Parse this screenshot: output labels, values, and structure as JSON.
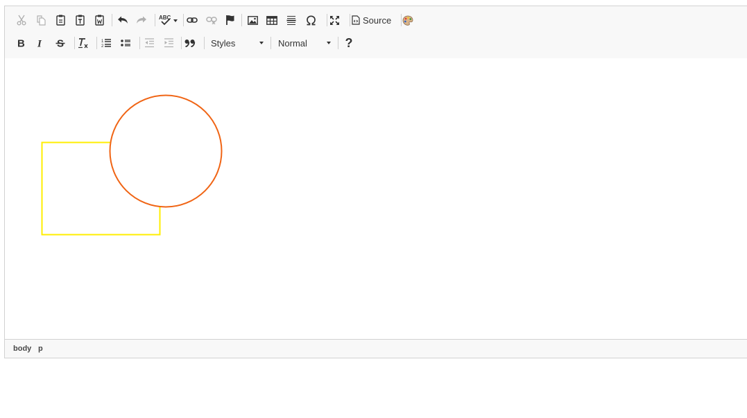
{
  "toolbar": {
    "source_label": "Source",
    "styles_label": "Styles",
    "format_label": "Normal",
    "help_label": "?",
    "icons": [
      "cut-icon",
      "copy-icon",
      "paste-icon",
      "paste-text-icon",
      "paste-word-icon",
      "undo-icon",
      "redo-icon",
      "spellcheck-icon",
      "link-icon",
      "unlink-icon",
      "anchor-icon",
      "image-icon",
      "table-icon",
      "horizontal-rule-icon",
      "special-char-omega-icon",
      "maximize-icon",
      "source-icon",
      "palette-icon",
      "bold-icon",
      "italic-icon",
      "strikethrough-icon",
      "remove-format-icon",
      "numbered-list-icon",
      "bulleted-list-icon",
      "outdent-icon",
      "indent-icon",
      "blockquote-icon",
      "help-icon"
    ],
    "spellcheck_text": "ABC"
  },
  "content": {
    "shapes": [
      {
        "type": "rect",
        "stroke": "#ffee00"
      },
      {
        "type": "circle",
        "stroke": "#f06414"
      }
    ]
  },
  "statusbar": {
    "path": [
      "body",
      "p"
    ]
  },
  "colors": {
    "toolbar_bg": "#f8f8f8",
    "border": "#d1d1d1",
    "icon": "#333333",
    "disabled_icon": "#b0b0b0"
  }
}
